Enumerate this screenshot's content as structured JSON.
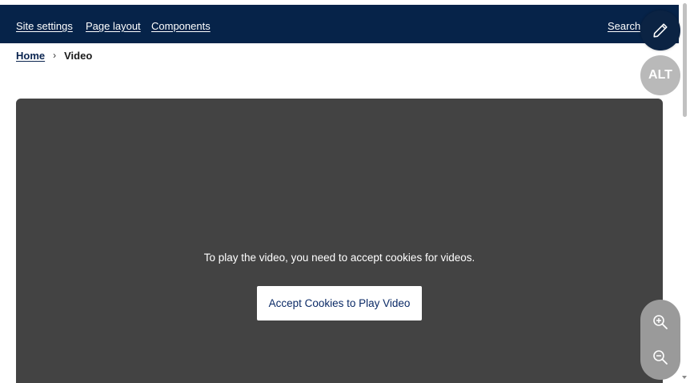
{
  "header": {
    "nav": [
      {
        "label": "Site settings"
      },
      {
        "label": "Page layout"
      },
      {
        "label": "Components"
      }
    ],
    "search_label": "Search"
  },
  "breadcrumb": {
    "home": "Home",
    "current": "Video"
  },
  "video": {
    "message": "To play the video, you need to accept cookies for videos.",
    "accept_button": "Accept Cookies to Play Video"
  },
  "floating_tools": {
    "edit_icon": "pencil-icon",
    "alt_label": "ALT",
    "zoom_in_icon": "zoom-in-icon",
    "zoom_out_icon": "zoom-out-icon"
  },
  "colors": {
    "header_bg": "#062349",
    "video_bg": "#434343",
    "button_text": "#0b2a66",
    "edit_bg": "#0b2343",
    "alt_bg": "#b9b9b9",
    "zoom_bg": "#9a9a9a"
  }
}
